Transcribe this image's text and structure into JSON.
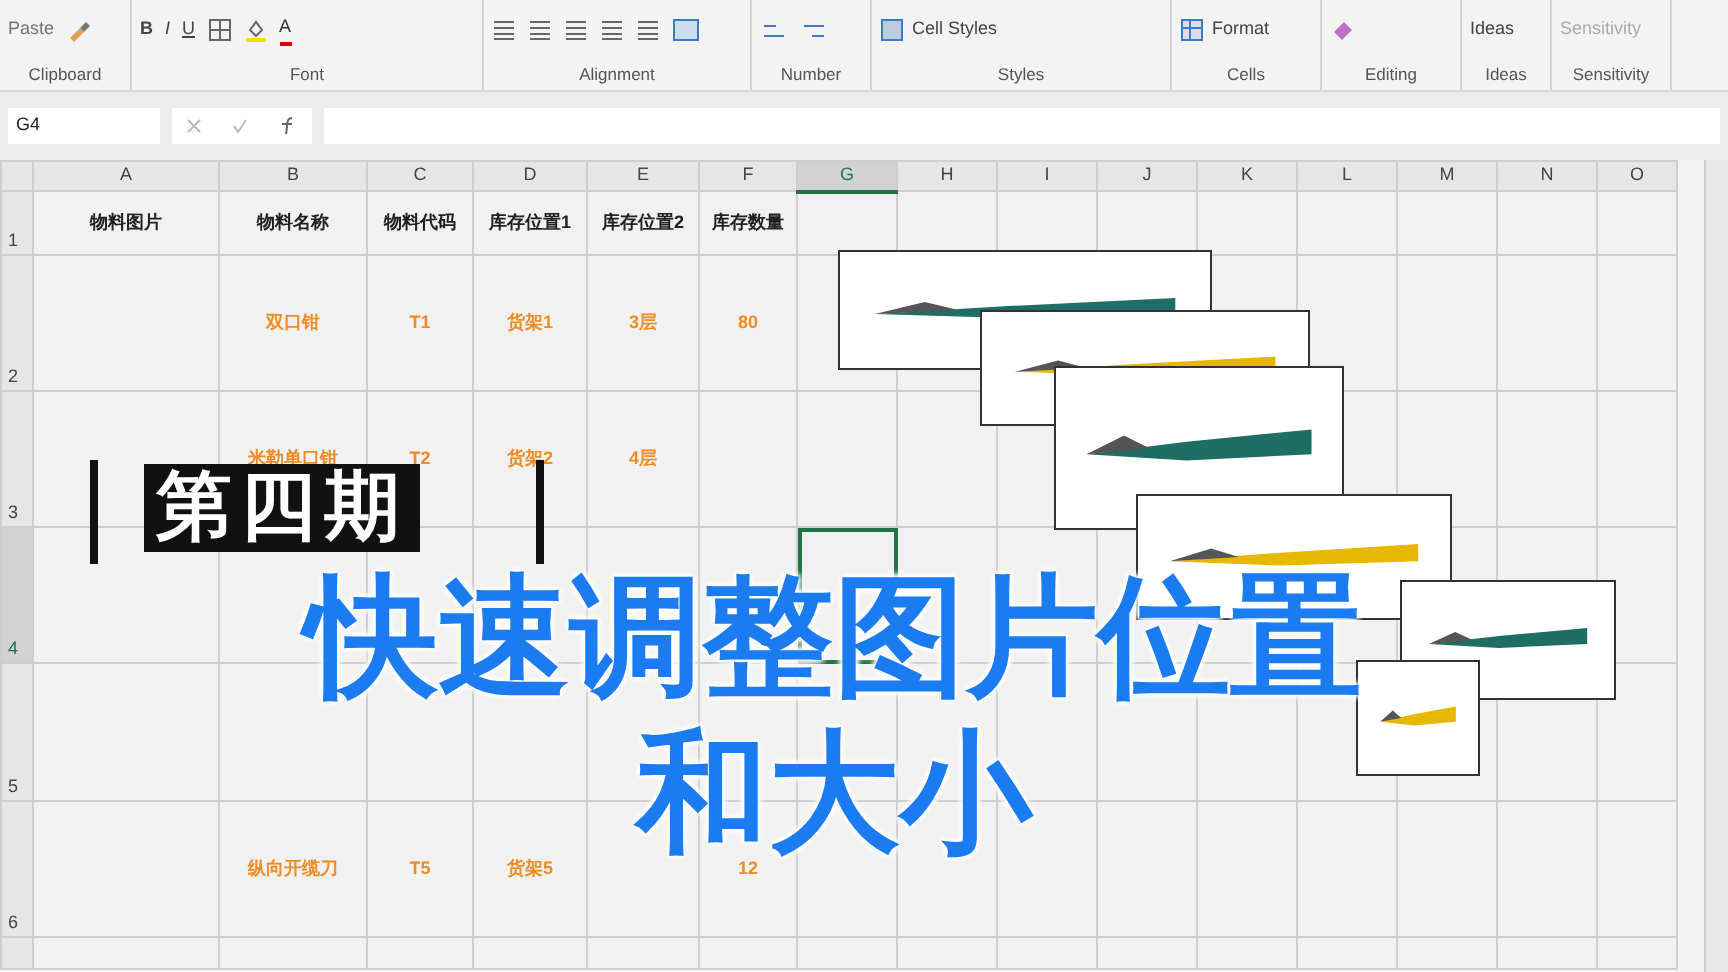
{
  "ribbon": {
    "groups": [
      {
        "label": "Clipboard",
        "kind": "clipboard",
        "texts": [
          "Paste"
        ]
      },
      {
        "label": "Font",
        "kind": "font",
        "texts": [
          "B",
          "I",
          "U",
          "A"
        ]
      },
      {
        "label": "Alignment",
        "kind": "alignment"
      },
      {
        "label": "Number",
        "kind": "number"
      },
      {
        "label": "Styles",
        "kind": "styles",
        "texts": [
          "Cell Styles"
        ]
      },
      {
        "label": "Cells",
        "kind": "cells",
        "texts": [
          "Format"
        ]
      },
      {
        "label": "Editing",
        "kind": "editing"
      },
      {
        "label": "Ideas",
        "kind": "ideas",
        "texts": [
          "Ideas"
        ]
      },
      {
        "label": "Sensitivity",
        "kind": "sensitivity",
        "texts": [
          "Sensitivity"
        ]
      }
    ]
  },
  "formula_bar": {
    "name_box": "G4"
  },
  "sheet": {
    "columns": [
      {
        "label": "A",
        "selected": false
      },
      {
        "label": "B",
        "selected": false
      },
      {
        "label": "C",
        "selected": false
      },
      {
        "label": "D",
        "selected": false
      },
      {
        "label": "E",
        "selected": false
      },
      {
        "label": "F",
        "selected": false
      },
      {
        "label": "G",
        "selected": true
      },
      {
        "label": "H",
        "selected": false
      },
      {
        "label": "I",
        "selected": false
      },
      {
        "label": "J",
        "selected": false
      },
      {
        "label": "K",
        "selected": false
      },
      {
        "label": "L",
        "selected": false
      },
      {
        "label": "M",
        "selected": false
      },
      {
        "label": "N",
        "selected": false
      },
      {
        "label": "O",
        "selected": false
      }
    ],
    "rows": [
      {
        "number": "1",
        "selected": false,
        "kind": "header",
        "cells": [
          "物料图片",
          "物料名称",
          "物料代码",
          "库存位置1",
          "库存位置2",
          "库存数量"
        ]
      },
      {
        "number": "2",
        "selected": false,
        "kind": "data",
        "cells": [
          null,
          "双口钳",
          "T1",
          "货架1",
          "3层",
          "80"
        ]
      },
      {
        "number": "3",
        "selected": false,
        "kind": "data",
        "cells": [
          null,
          "米勒单口钳",
          "T2",
          "货架2",
          "4层",
          null
        ]
      },
      {
        "number": "4",
        "selected": true,
        "kind": "data",
        "cells": [
          null,
          null,
          null,
          null,
          null,
          null
        ]
      },
      {
        "number": "5",
        "selected": false,
        "kind": "data",
        "cells": [
          null,
          null,
          null,
          null,
          null,
          null
        ]
      },
      {
        "number": "6",
        "selected": false,
        "kind": "data",
        "cells": [
          null,
          "纵向开缆刀",
          "T5",
          "货架5",
          null,
          "12"
        ]
      }
    ]
  },
  "overlay": {
    "episode": "第四期",
    "title_lines": [
      "快速调整图片位置",
      "和大小"
    ]
  }
}
